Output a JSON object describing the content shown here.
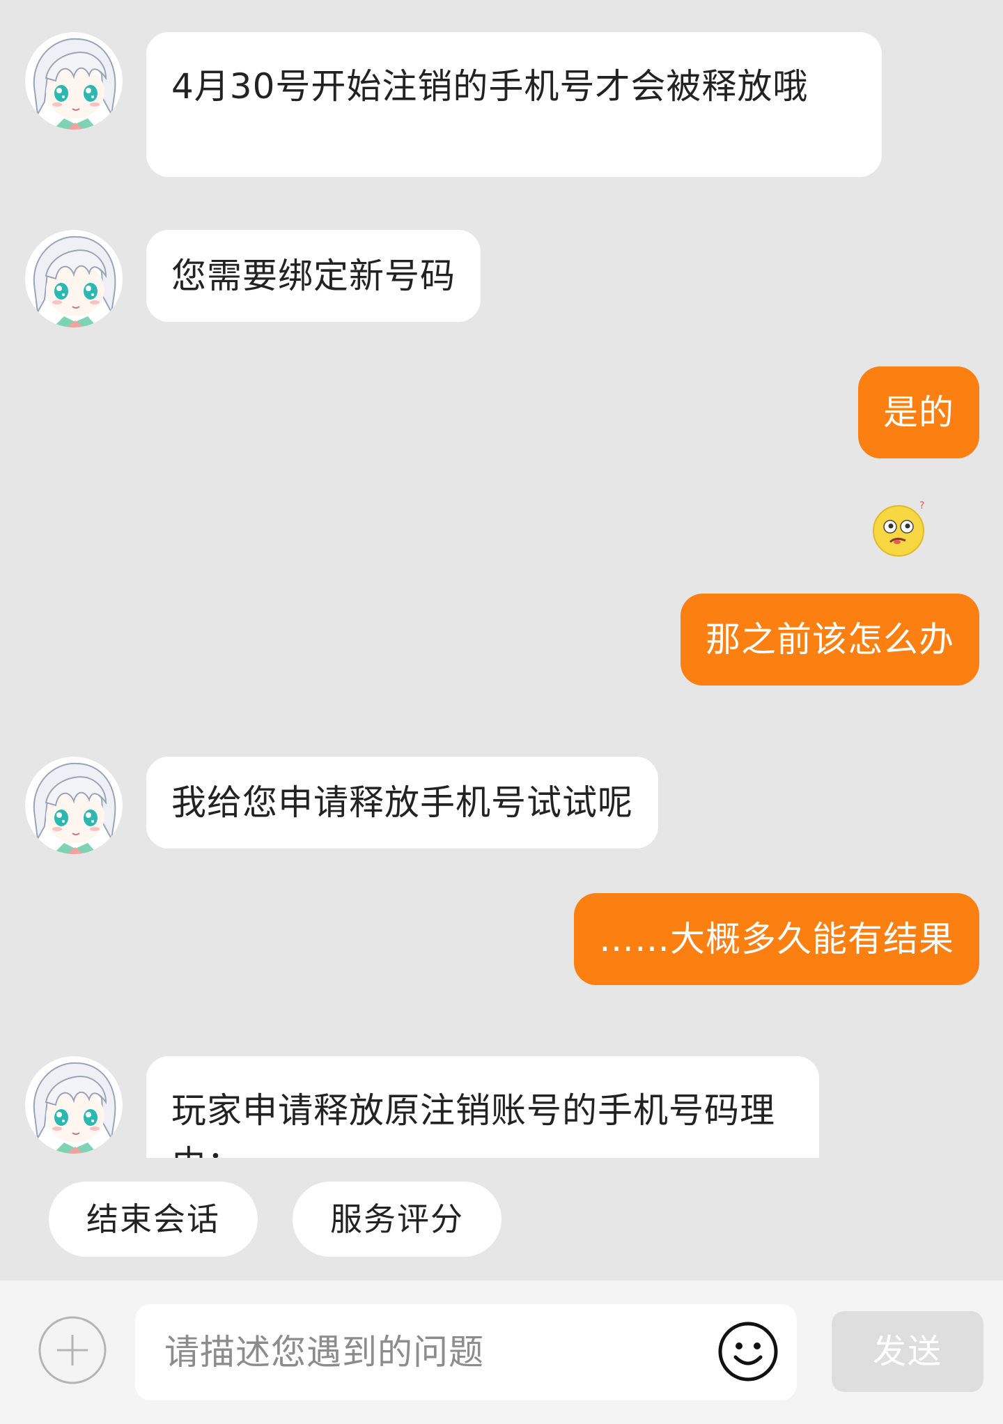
{
  "messages": [
    {
      "side": "in",
      "text": "4月30号开始注销的手机号才会被释放哦",
      "avatar": "anime-avatar-icon"
    },
    {
      "side": "in",
      "text": "您需要绑定新号码",
      "avatar": "anime-avatar-icon"
    },
    {
      "side": "out",
      "text": "是的"
    },
    {
      "side": "out",
      "emoji": "confused-face-emoji"
    },
    {
      "side": "out",
      "text": "那之前该怎么办"
    },
    {
      "side": "in",
      "text": "我给您申请释放手机号试试呢",
      "avatar": "anime-avatar-icon"
    },
    {
      "side": "out",
      "text": "……大概多久能有结果"
    },
    {
      "side": "in",
      "text": "玩家申请释放原注销账号的手机号码理由：",
      "avatar": "anime-avatar-icon"
    }
  ],
  "quick_actions": {
    "end_session": "结束会话",
    "service_rating": "服务评分"
  },
  "input": {
    "placeholder": "请描述您遇到的问题",
    "send_label": "发送",
    "plus_icon": "plus-icon",
    "emoji_icon": "smiley-icon"
  },
  "colors": {
    "background": "#e6e6e6",
    "outgoing_bubble": "#fb7f11",
    "incoming_bubble": "#ffffff",
    "input_bar": "#f4f4f4",
    "send_disabled": "#dedede"
  }
}
